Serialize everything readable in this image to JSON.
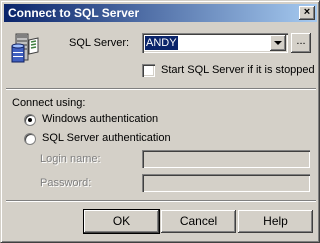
{
  "window": {
    "title": "Connect to SQL Server",
    "close_glyph": "×"
  },
  "server": {
    "icon": "sql-server-icon",
    "label": "SQL Server:",
    "value": "ANDY",
    "browse_label": "...",
    "start_checkbox_label": "Start SQL Server if it is stopped",
    "start_checkbox_checked": false
  },
  "auth": {
    "heading": "Connect using:",
    "windows_label": "Windows authentication",
    "windows_selected": true,
    "sql_label": "SQL Server authentication",
    "sql_selected": false,
    "login_label": "Login name:",
    "login_value": "",
    "password_label": "Password:",
    "password_value": ""
  },
  "buttons": {
    "ok": "OK",
    "cancel": "Cancel",
    "help": "Help"
  },
  "colors": {
    "dialog_face": "#d4d0c8",
    "title_start": "#0a246a",
    "title_end": "#a6caf0",
    "selection": "#0a246a",
    "disabled_text": "#808080"
  }
}
